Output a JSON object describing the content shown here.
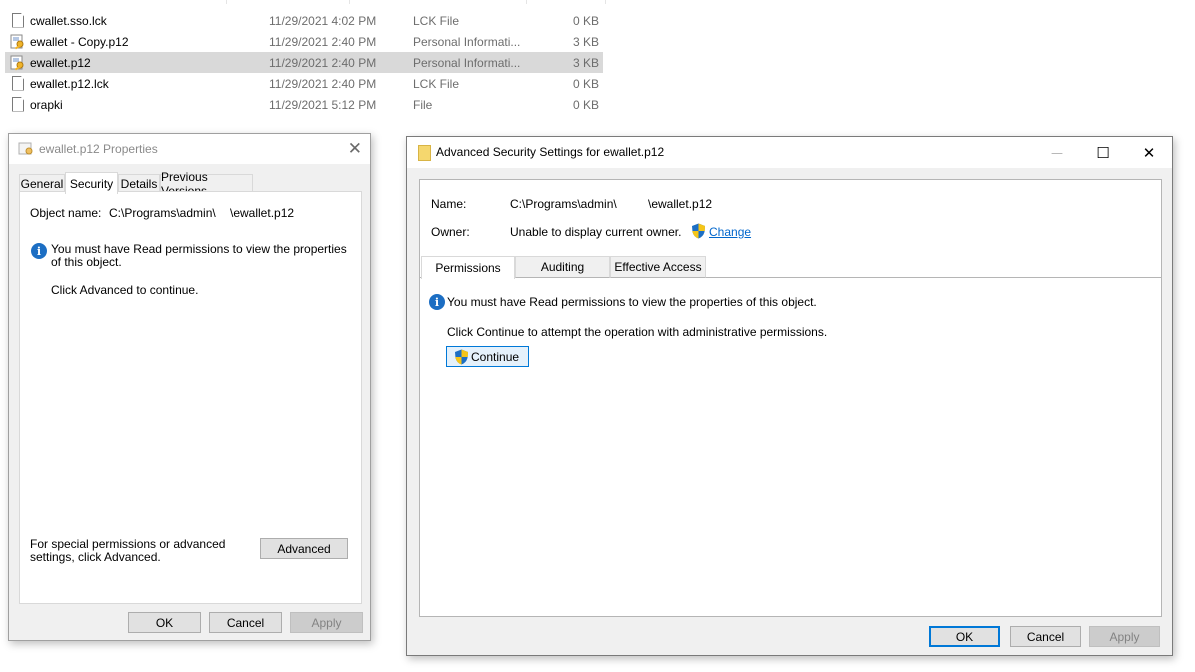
{
  "explorer": {
    "files": [
      {
        "name": "cwallet.sso.lck",
        "icon": "document-icon",
        "date": "11/29/2021 4:02 PM",
        "type": "LCK File",
        "size": "0 KB",
        "selected": false
      },
      {
        "name": "ewallet - Copy.p12",
        "icon": "certificate-icon",
        "date": "11/29/2021 2:40 PM",
        "type": "Personal Informati...",
        "size": "3 KB",
        "selected": false
      },
      {
        "name": "ewallet.p12",
        "icon": "certificate-icon",
        "date": "11/29/2021 2:40 PM",
        "type": "Personal Informati...",
        "size": "3 KB",
        "selected": true
      },
      {
        "name": "ewallet.p12.lck",
        "icon": "document-icon",
        "date": "11/29/2021 2:40 PM",
        "type": "LCK File",
        "size": "0 KB",
        "selected": false
      },
      {
        "name": "orapki",
        "icon": "document-icon",
        "date": "11/29/2021 5:12 PM",
        "type": "File",
        "size": "0 KB",
        "selected": false
      }
    ]
  },
  "properties_dialog": {
    "title": "ewallet.p12 Properties",
    "close_label": "✕",
    "tabs": [
      {
        "label": "General",
        "active": false
      },
      {
        "label": "Security",
        "active": true
      },
      {
        "label": "Details",
        "active": false
      },
      {
        "label": "Previous Versions",
        "active": false
      }
    ],
    "object_name_label": "Object name:",
    "object_name_path_start": "C:\\Programs\\admin\\",
    "object_name_path_end": "\\ewallet.p12",
    "info_message": "You must have Read permissions to view the properties of this object.",
    "instruction": "Click Advanced to continue.",
    "advanced_hint": "For special permissions or advanced settings, click Advanced.",
    "advanced_button": "Advanced",
    "ok_button": "OK",
    "cancel_button": "Cancel",
    "apply_button": "Apply"
  },
  "advanced_dialog": {
    "title": "Advanced Security Settings for ewallet.p12",
    "minimize_label": "—",
    "maximize_label": "☐",
    "close_label": "✕",
    "name_label": "Name:",
    "name_value_start": "C:\\Programs\\admin\\",
    "name_value_end": "\\ewallet.p12",
    "owner_label": "Owner:",
    "owner_value": "Unable to display current owner.",
    "change_link": "Change",
    "tabs": [
      {
        "label": "Permissions",
        "active": true
      },
      {
        "label": "Auditing",
        "active": false
      },
      {
        "label": "Effective Access",
        "active": false
      }
    ],
    "info_message": "You must have Read permissions to view the properties of this object.",
    "instruction": "Click Continue to attempt the operation with administrative permissions.",
    "continue_button": "Continue",
    "ok_button": "OK",
    "cancel_button": "Cancel",
    "apply_button": "Apply"
  },
  "colors": {
    "selection": "#d9d9d9",
    "accent": "#0078d7",
    "link": "#0066cc",
    "info": "#1c6ec3"
  }
}
